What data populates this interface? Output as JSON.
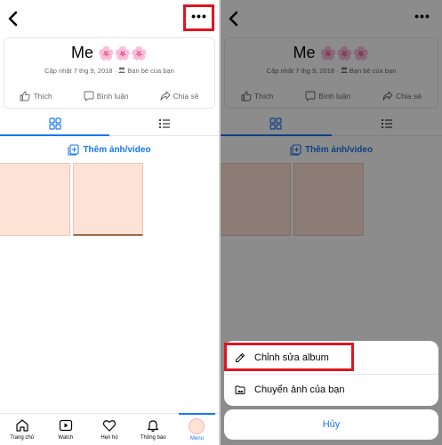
{
  "album": {
    "title": "Me",
    "emojis": "🌸🌸🌸",
    "updated": "Cập nhật 7 thg 9, 2018",
    "dot": "·",
    "audience": "Bạn bè của bạn"
  },
  "actions": {
    "like": "Thích",
    "comment": "Bình luận",
    "share": "Chia sẻ"
  },
  "add_media": "Thêm ảnh/video",
  "bottom_nav": [
    {
      "label": "Trang chủ",
      "icon": "home-icon"
    },
    {
      "label": "Watch",
      "icon": "watch-icon"
    },
    {
      "label": "Hẹn hò",
      "icon": "heart-icon"
    },
    {
      "label": "Thông báo",
      "icon": "bell-icon"
    },
    {
      "label": "Menu",
      "icon": "avatar"
    }
  ],
  "sheet": {
    "edit_album": "Chỉnh sửa album",
    "move_photos": "Chuyển ảnh của bạn",
    "cancel": "Hủy"
  },
  "colors": {
    "accent": "#1877f2",
    "highlight": "#e0141e",
    "photo": "#fde3d5"
  }
}
